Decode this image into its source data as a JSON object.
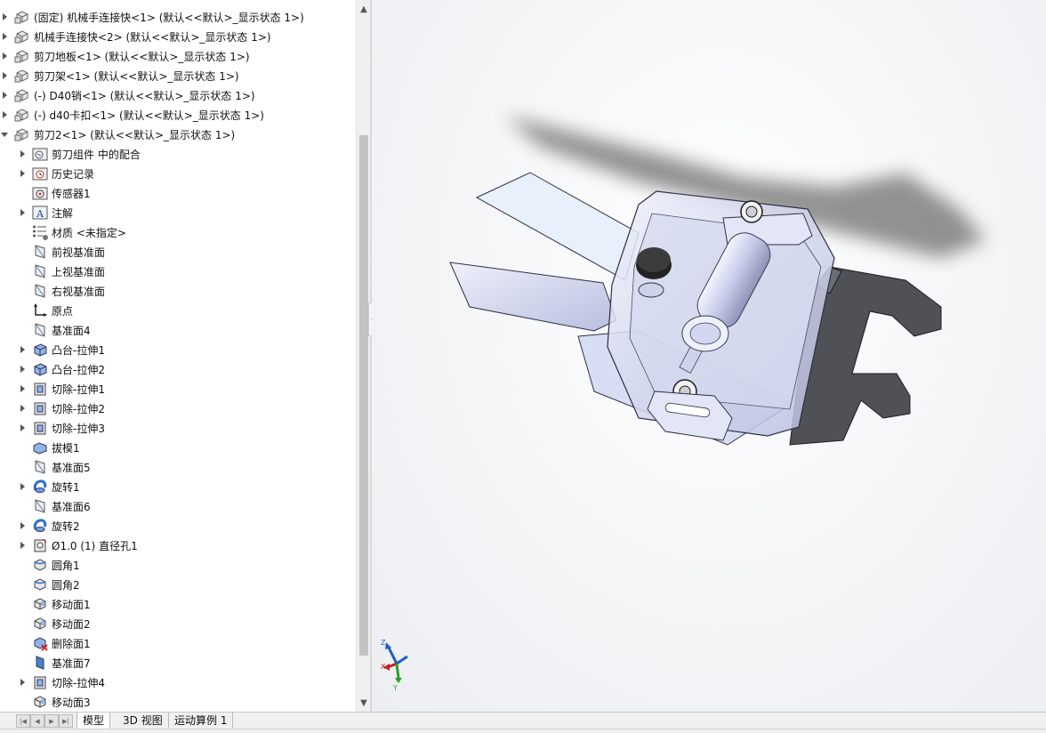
{
  "tree": {
    "items": [
      {
        "label": "(固定) 机械手连接快<1> (默认<<默认>_显示状态 1>)",
        "icon": "assembly-part-icon",
        "indent": 0,
        "expander": "right"
      },
      {
        "label": "机械手连接快<2> (默认<<默认>_显示状态 1>)",
        "icon": "assembly-part-icon",
        "indent": 0,
        "expander": "right"
      },
      {
        "label": "剪刀地板<1> (默认<<默认>_显示状态 1>)",
        "icon": "assembly-part-icon",
        "indent": 0,
        "expander": "right"
      },
      {
        "label": "剪刀架<1> (默认<<默认>_显示状态 1>)",
        "icon": "assembly-part-icon",
        "indent": 0,
        "expander": "right"
      },
      {
        "label": "(-) D40销<1> (默认<<默认>_显示状态 1>)",
        "icon": "assembly-part-icon",
        "indent": 0,
        "expander": "right"
      },
      {
        "label": "(-) d40卡扣<1> (默认<<默认>_显示状态 1>)",
        "icon": "assembly-part-icon",
        "indent": 0,
        "expander": "right"
      },
      {
        "label": "剪刀2<1> (默认<<默认>_显示状态 1>)",
        "icon": "assembly-part-icon",
        "indent": 0,
        "expander": "down"
      },
      {
        "label": "剪刀组件 中的配合",
        "icon": "mates-folder-icon",
        "indent": 1,
        "expander": "right"
      },
      {
        "label": "历史记录",
        "icon": "history-icon",
        "indent": 1,
        "expander": "right"
      },
      {
        "label": "传感器1",
        "icon": "sensor-icon",
        "indent": 1,
        "expander": "none"
      },
      {
        "label": "注解",
        "icon": "annotation-icon",
        "indent": 1,
        "expander": "right"
      },
      {
        "label": "材质 <未指定>",
        "icon": "material-icon",
        "indent": 1,
        "expander": "none"
      },
      {
        "label": "前视基准面",
        "icon": "plane-icon",
        "indent": 1,
        "expander": "none"
      },
      {
        "label": "上视基准面",
        "icon": "plane-icon",
        "indent": 1,
        "expander": "none"
      },
      {
        "label": "右视基准面",
        "icon": "plane-icon",
        "indent": 1,
        "expander": "none"
      },
      {
        "label": "原点",
        "icon": "origin-icon",
        "indent": 1,
        "expander": "none"
      },
      {
        "label": "基准面4",
        "icon": "plane-icon",
        "indent": 1,
        "expander": "none"
      },
      {
        "label": "凸台-拉伸1",
        "icon": "boss-extrude-icon",
        "indent": 1,
        "expander": "right"
      },
      {
        "label": "凸台-拉伸2",
        "icon": "boss-extrude-icon",
        "indent": 1,
        "expander": "right"
      },
      {
        "label": "切除-拉伸1",
        "icon": "cut-extrude-icon",
        "indent": 1,
        "expander": "right"
      },
      {
        "label": "切除-拉伸2",
        "icon": "cut-extrude-icon",
        "indent": 1,
        "expander": "right"
      },
      {
        "label": "切除-拉伸3",
        "icon": "cut-extrude-icon",
        "indent": 1,
        "expander": "right"
      },
      {
        "label": "拔模1",
        "icon": "draft-icon",
        "indent": 1,
        "expander": "none"
      },
      {
        "label": "基准面5",
        "icon": "plane-icon",
        "indent": 1,
        "expander": "none"
      },
      {
        "label": "旋转1",
        "icon": "revolve-icon",
        "indent": 1,
        "expander": "right"
      },
      {
        "label": "基准面6",
        "icon": "plane-icon",
        "indent": 1,
        "expander": "none"
      },
      {
        "label": "旋转2",
        "icon": "revolve-icon",
        "indent": 1,
        "expander": "right"
      },
      {
        "label": "Ø1.0 (1) 直径孔1",
        "icon": "hole-wizard-icon",
        "indent": 1,
        "expander": "right"
      },
      {
        "label": "圆角1",
        "icon": "fillet-icon",
        "indent": 1,
        "expander": "none"
      },
      {
        "label": "圆角2",
        "icon": "fillet-icon",
        "indent": 1,
        "expander": "none"
      },
      {
        "label": "移动面1",
        "icon": "move-face-icon",
        "indent": 1,
        "expander": "none"
      },
      {
        "label": "移动面2",
        "icon": "move-face-icon",
        "indent": 1,
        "expander": "none"
      },
      {
        "label": "删除面1",
        "icon": "delete-face-icon",
        "indent": 1,
        "expander": "none"
      },
      {
        "label": "基准面7",
        "icon": "plane-blue-icon",
        "indent": 1,
        "expander": "none"
      },
      {
        "label": "切除-拉伸4",
        "icon": "cut-extrude-icon",
        "indent": 1,
        "expander": "right"
      },
      {
        "label": "移动面3",
        "icon": "move-face-icon",
        "indent": 1,
        "expander": "none"
      }
    ]
  },
  "tabs": [
    {
      "label": "模型",
      "active": true
    },
    {
      "label": "3D 视图",
      "active": false
    },
    {
      "label": "运动算例 1",
      "active": false
    }
  ],
  "triad": {
    "z": "Z",
    "x": "X",
    "y": "Y"
  },
  "colors": {
    "accent": "#1f5fbf",
    "part_tint": "#c9cde8",
    "shadow": "#555555"
  }
}
